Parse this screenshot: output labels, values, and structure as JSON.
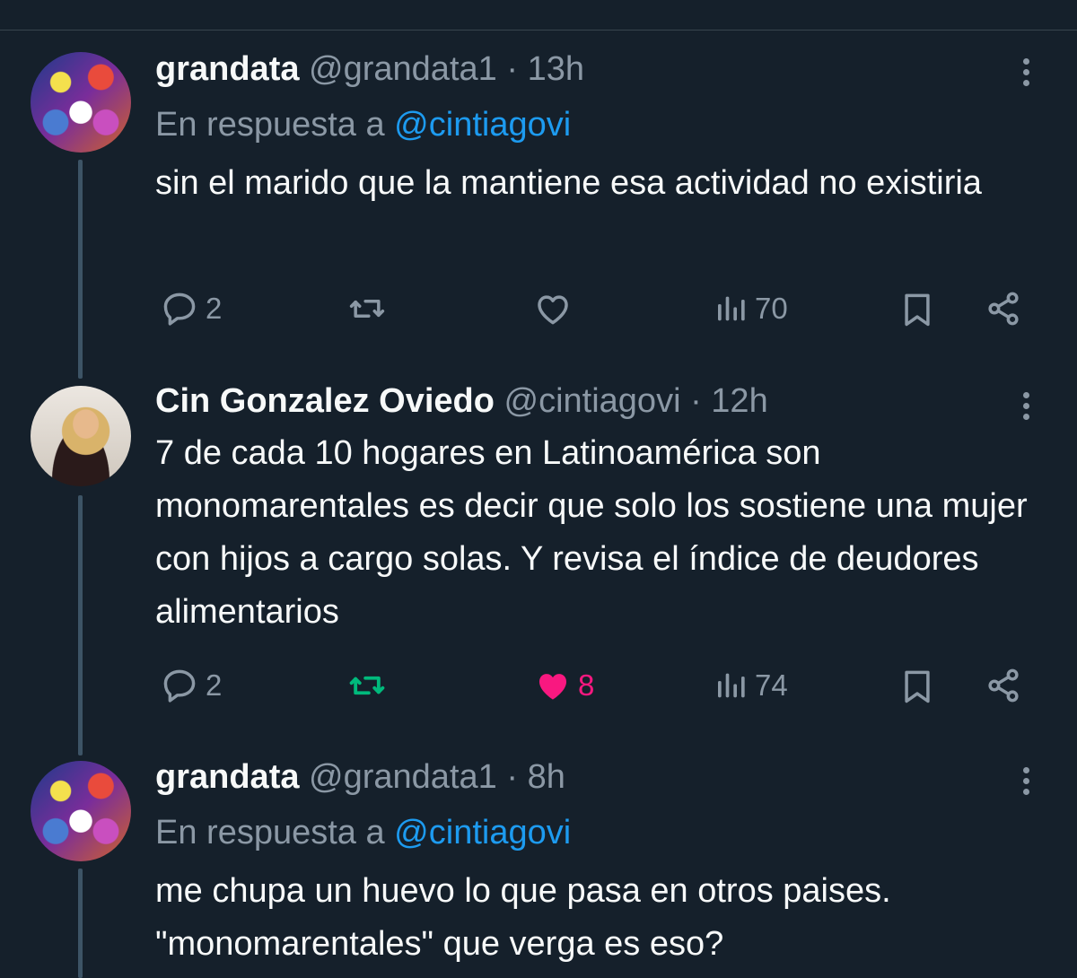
{
  "tweets": [
    {
      "name": "grandata",
      "handle": "@grandata1",
      "separator": "·",
      "time": "13h",
      "reply_prefix": "En respuesta a",
      "reply_to": "@cintiagovi",
      "text": "sin el marido que la mantiene esa actividad no existiria",
      "replies": "2",
      "retweets": "",
      "likes": "",
      "views": "70",
      "liked": false,
      "retweeted": false
    },
    {
      "name": "Cin Gonzalez Oviedo",
      "handle": "@cintiagovi",
      "separator": "·",
      "time": "12h",
      "text": "7 de cada 10 hogares en Latinoamérica son monomarentales es decir que solo los sostiene una mujer con hijos a cargo solas. Y revisa el índice de deudores alimentarios",
      "replies": "2",
      "retweets": "",
      "likes": "8",
      "views": "74",
      "liked": true,
      "retweeted": true
    },
    {
      "name": "grandata",
      "handle": "@grandata1",
      "separator": "·",
      "time": "8h",
      "reply_prefix": "En respuesta a",
      "reply_to": "@cintiagovi",
      "text": "me chupa un huevo lo que pasa en otros paises. \"monomarentales\" que verga es eso?"
    }
  ],
  "colors": {
    "background": "#15202b",
    "text": "#f7f9f9",
    "muted": "#8b98a5",
    "link": "#1d9bf0",
    "like": "#f91880",
    "retweet": "#00ba7c"
  },
  "icons": [
    "reply-icon",
    "retweet-icon",
    "like-icon",
    "views-icon",
    "bookmark-icon",
    "share-icon",
    "more-icon"
  ]
}
